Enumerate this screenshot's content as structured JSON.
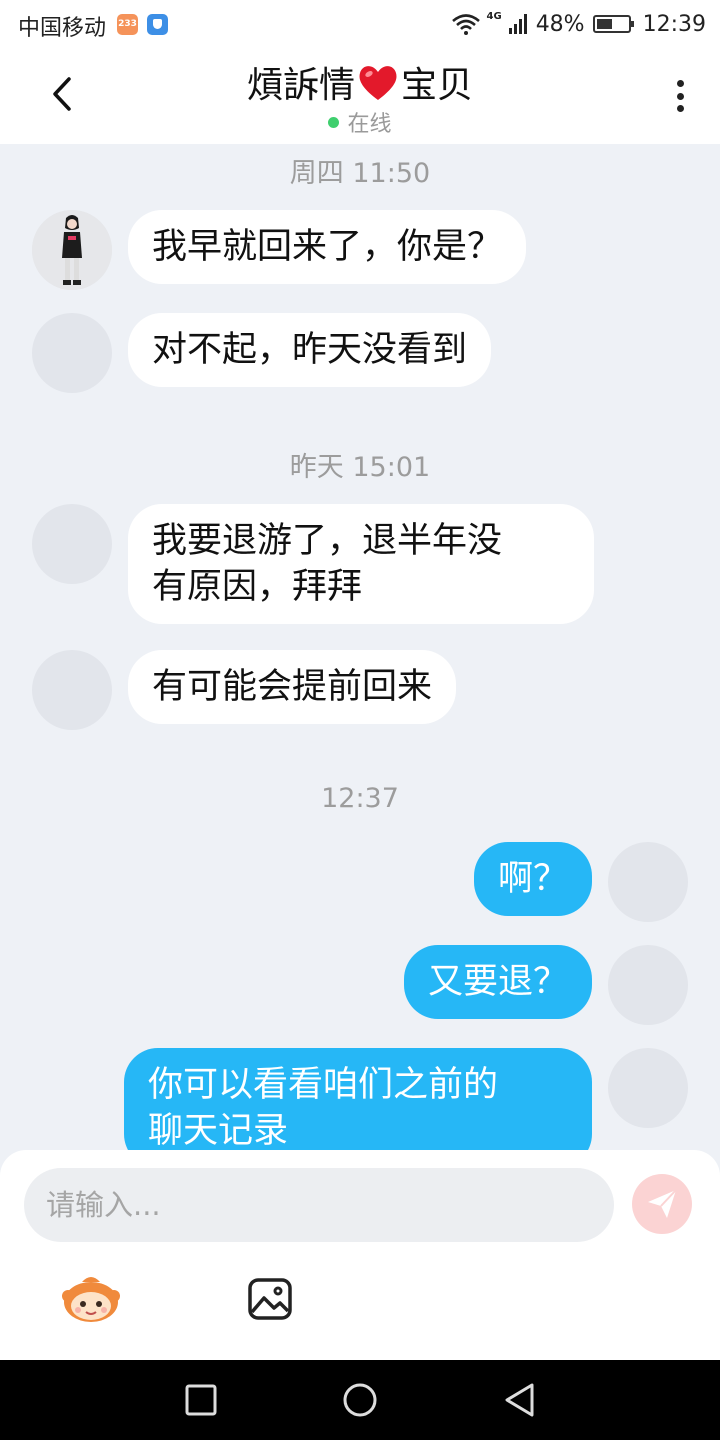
{
  "status_bar": {
    "carrier": "中国移动",
    "badge": "233",
    "network": "4G",
    "battery": "48%",
    "time": "12:39"
  },
  "header": {
    "title_left": "熕訴情",
    "title_right": "宝贝",
    "status": "在线"
  },
  "messages": [
    {
      "type": "timestamp",
      "text": "周四 11:50"
    },
    {
      "type": "incoming",
      "text": "我早就回来了，你是？"
    },
    {
      "type": "incoming",
      "text": "对不起，昨天没看到"
    },
    {
      "type": "timestamp",
      "text": "昨天 15:01"
    },
    {
      "type": "incoming",
      "text": "我要退游了，退半年没有原因，拜拜",
      "line1": "我要退游了，退半年没",
      "line2": "有原因，拜拜"
    },
    {
      "type": "incoming",
      "text": "有可能会提前回来"
    },
    {
      "type": "timestamp",
      "text": "12:37"
    },
    {
      "type": "outgoing",
      "text": "啊？"
    },
    {
      "type": "outgoing",
      "text": "又要退？"
    },
    {
      "type": "outgoing",
      "text": "你可以看看咱们之前的聊天记录",
      "line1": "你可以看看咱们之前的",
      "line2": "聊天记录"
    }
  ],
  "input": {
    "placeholder": "请输入..."
  },
  "colors": {
    "outgoing_bubble": "#26b7f6",
    "incoming_bubble": "#ffffff",
    "online_dot": "#3fcf6e",
    "send_button": "#fbd3d3",
    "chat_background": "#eef1f6"
  },
  "icons": [
    "back-icon",
    "heart-icon",
    "more-icon",
    "send-icon",
    "emoji-icon",
    "image-icon",
    "nav-recent-icon",
    "nav-home-icon",
    "nav-back-icon"
  ]
}
